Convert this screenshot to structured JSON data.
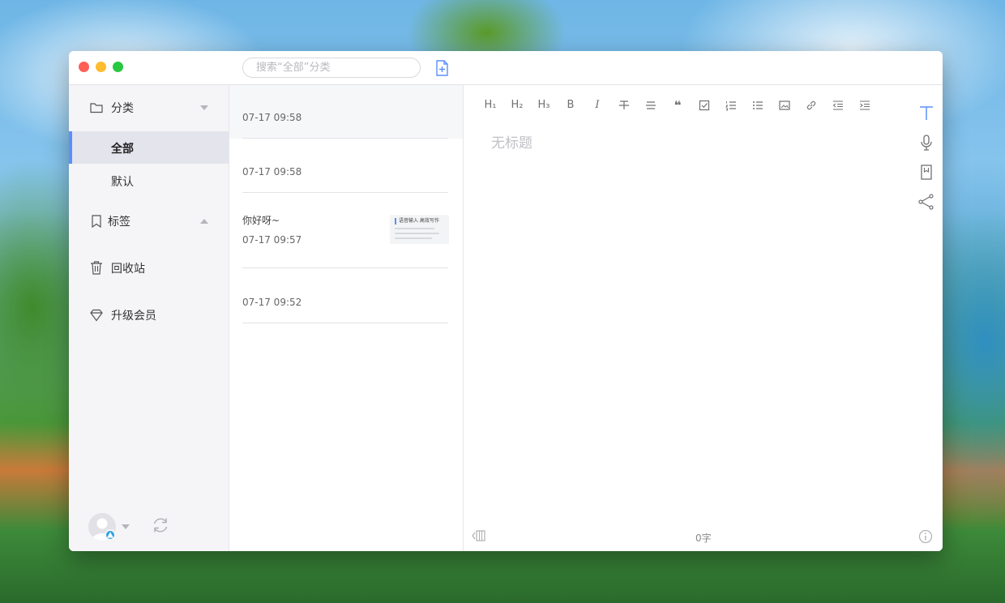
{
  "search": {
    "placeholder": "搜索“全部”分类"
  },
  "sidebar": {
    "category_label": "分类",
    "sub_items": [
      "全部",
      "默认"
    ],
    "tags_label": "标签",
    "trash_label": "回收站",
    "upgrade_label": "升级会员"
  },
  "notes": [
    {
      "title": "",
      "date": "07-17 09:58",
      "selected": true
    },
    {
      "title": "",
      "date": "07-17 09:58",
      "selected": false
    },
    {
      "title": "你好呀~",
      "date": "07-17 09:57",
      "selected": false,
      "thumbnail_title": "语音输入 高效写作"
    },
    {
      "title": "",
      "date": "07-17 09:52",
      "selected": false
    }
  ],
  "toolbar": {
    "h1": "H₁",
    "h2": "H₂",
    "h3": "H₃",
    "bold": "B",
    "italic": "I"
  },
  "editor": {
    "title_placeholder": "无标题",
    "word_count": "0字"
  },
  "colors": {
    "accent": "#5b8ff9"
  }
}
